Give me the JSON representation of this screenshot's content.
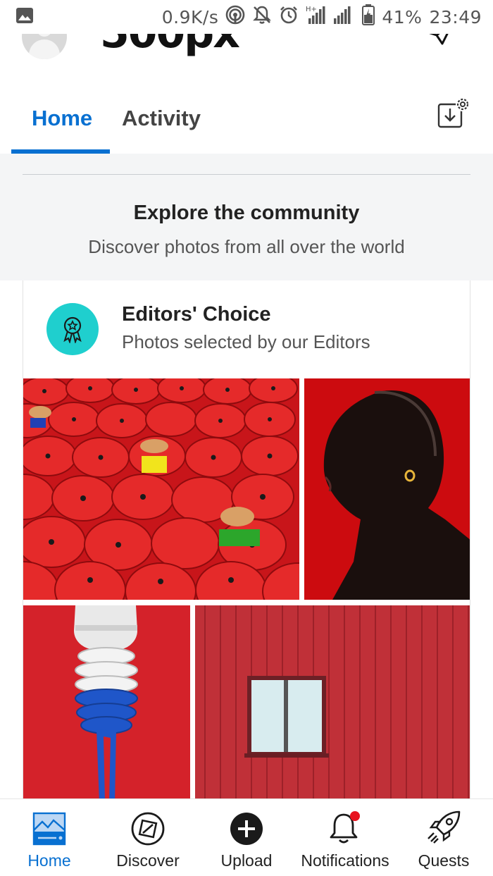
{
  "status_bar": {
    "network_speed": "0.9K/s",
    "network_type": "H+",
    "battery": "41%",
    "time": "23:49",
    "icons": [
      "gallery-icon",
      "hotspot-icon",
      "notifications-off-icon",
      "alarm-icon",
      "signal-icon",
      "battery-icon"
    ]
  },
  "header": {
    "brand": "500px",
    "icons": [
      "avatar",
      "paper-plane-icon"
    ]
  },
  "tabs": [
    {
      "label": "Home",
      "active": true
    },
    {
      "label": "Activity",
      "active": false
    }
  ],
  "explore": {
    "title": "Explore the community",
    "subtitle": "Discover photos from all over the world"
  },
  "editors_choice": {
    "title": "Editors' Choice",
    "subtitle": "Photos selected by our Editors",
    "badge_icon": "award-ribbon-icon",
    "badge_color": "#1fcfce",
    "photos": [
      "red-umbrellas-photo",
      "portrait-photo",
      "lightbulb-photo",
      "red-wall-window-photo"
    ]
  },
  "bottom_nav": [
    {
      "label": "Home",
      "icon": "home-landscape-icon",
      "active": true
    },
    {
      "label": "Discover",
      "icon": "discover-compass-icon",
      "active": false
    },
    {
      "label": "Upload",
      "icon": "upload-plus-icon",
      "active": false
    },
    {
      "label": "Notifications",
      "icon": "bell-icon",
      "active": false,
      "has_dot": true
    },
    {
      "label": "Quests",
      "icon": "rocket-icon",
      "active": false
    }
  ],
  "colors": {
    "accent": "#0870d1",
    "badge": "#1fcfce",
    "notification_dot": "#e8131f"
  }
}
